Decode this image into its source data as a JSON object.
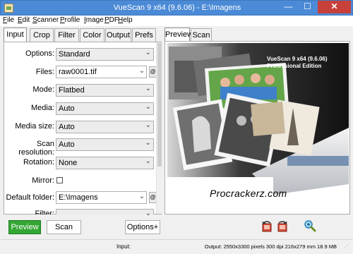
{
  "window": {
    "title": "VueScan 9 x64 (9.6.06) - E:\\Imagens",
    "min_glyph": "—",
    "max_glyph": "☐",
    "close_glyph": "✕"
  },
  "menu": [
    "File",
    "Edit",
    "Scanner",
    "Profile",
    "Image",
    "PDF",
    "Help"
  ],
  "left_tabs": [
    "Input",
    "Crop",
    "Filter",
    "Color",
    "Output",
    "Prefs"
  ],
  "settings": {
    "options": {
      "label": "Options:",
      "value": "Standard"
    },
    "files": {
      "label": "Files:",
      "value": "raw0001.tif",
      "button": "@"
    },
    "mode": {
      "label": "Mode:",
      "value": "Flatbed"
    },
    "media": {
      "label": "Media:",
      "value": "Auto"
    },
    "media_size": {
      "label": "Media size:",
      "value": "Auto"
    },
    "scan_resolution": {
      "label": "Scan resolution:",
      "value": "Auto"
    },
    "rotation": {
      "label": "Rotation:",
      "value": "None"
    },
    "mirror": {
      "label": "Mirror:",
      "checked": false
    },
    "default_folder": {
      "label": "Default folder:",
      "value": "E:\\Imagens",
      "button": "@"
    },
    "partial_label": "Filter:"
  },
  "right_tabs": [
    "Preview",
    "Scan"
  ],
  "splash": {
    "line1": "VueScan 9 x64 (9.6.06)",
    "line2": "Professional Edition",
    "watermark": "Procrackerz.com"
  },
  "buttons": {
    "preview": "Preview",
    "scan": "Scan",
    "options": "Options+"
  },
  "toolbar_icons": [
    "rotate-left-icon",
    "rotate-right-icon",
    "zoom-icon"
  ],
  "status": {
    "input": "Input:",
    "output": "Output: 2550x3300 pixels 300 dpi 216x279 mm 18.9 MB"
  },
  "colors": {
    "titlebar": "#4b8ad6",
    "close_button": "#c7403a",
    "preview_button": "#34a634"
  }
}
